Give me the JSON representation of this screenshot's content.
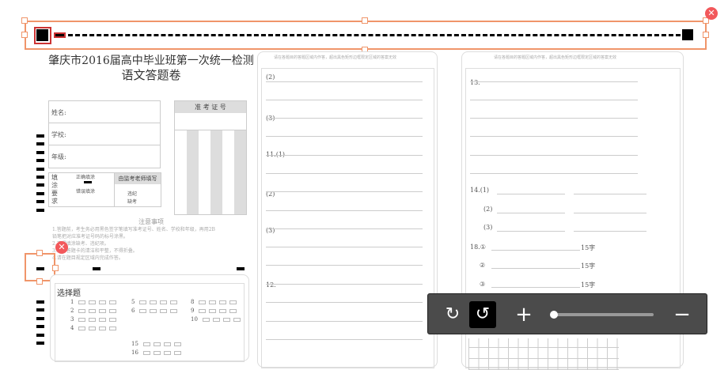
{
  "doc": {
    "title_line1": "肇庆市2016届高中毕业班第一次统一检测",
    "title_line2": "语文答题卷",
    "fields": [
      "姓名:",
      "学校:",
      "年级:"
    ],
    "fill_req": "填涂要求",
    "correct_fill": "正确填涂",
    "wrong_fill": "错误填涂",
    "proctor": "由监考老师填写",
    "violation": "违纪",
    "absent": "缺考",
    "ticket_header": "准 考 证 号",
    "notes_title": "注意事项",
    "notes": [
      "1.答题前，考生务必用黑色签字笔填写准考证号、姓名、学校和年级，再用2B",
      "铅笔把对应准考证号码的标号涂黑。",
      "2.不得填涂缺考、违纪项。",
      "3.保持答题卡的清洁和平整，不得折叠。",
      "4.请在题目规定区域内完成作答。"
    ],
    "choice_title": "选择题",
    "choice_nums": [
      "1",
      "2",
      "3",
      "4",
      "5",
      "6",
      "8",
      "9",
      "10",
      "15",
      "16"
    ],
    "page_header": "请在各题目的答题区域内作答，超出黑色矩形边框限定区域的答案无效",
    "mid_labels": [
      "(2)",
      "(3)",
      "11.(1)",
      "(2)",
      "(3)",
      "12."
    ],
    "right_labels": [
      "13.",
      "14.(1)",
      "(2)",
      "(3)",
      "18.①",
      "②",
      "③"
    ],
    "char_limit": "15字"
  },
  "toolbar": {
    "redo": "redo-icon",
    "undo": "undo-icon",
    "zoom_in": "+",
    "zoom_out": "−",
    "zoom_level": 0
  }
}
